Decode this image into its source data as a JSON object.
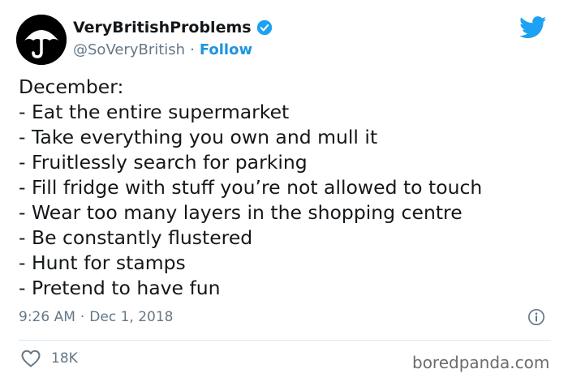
{
  "author": {
    "display_name": "VeryBritishProblems",
    "handle": "@SoVeryBritish",
    "separator": "·",
    "follow_label": "Follow",
    "verified": true,
    "avatar_icon": "umbrella-icon"
  },
  "tweet": {
    "lines": [
      "December:",
      "- Eat the entire supermarket",
      "- Take everything you own and mull it",
      "- Fruitlessly search for parking",
      "- Fill fridge with stuff you’re not allowed to touch",
      "- Wear too many layers in the shopping centre",
      "- Be constantly flustered",
      "- Hunt for stamps",
      "- Pretend to have fun"
    ],
    "time": "9:26 AM",
    "date_separator": "·",
    "date": "Dec 1, 2018",
    "like_count": "18K"
  },
  "watermark": "boredpanda.com",
  "colors": {
    "twitter_blue": "#1da1f2",
    "link_blue": "#1b95e0",
    "secondary_text": "#657786",
    "primary_text": "#14171a"
  },
  "icons": [
    "umbrella-icon",
    "verified-badge-icon",
    "twitter-bird-icon",
    "info-icon",
    "heart-icon"
  ]
}
